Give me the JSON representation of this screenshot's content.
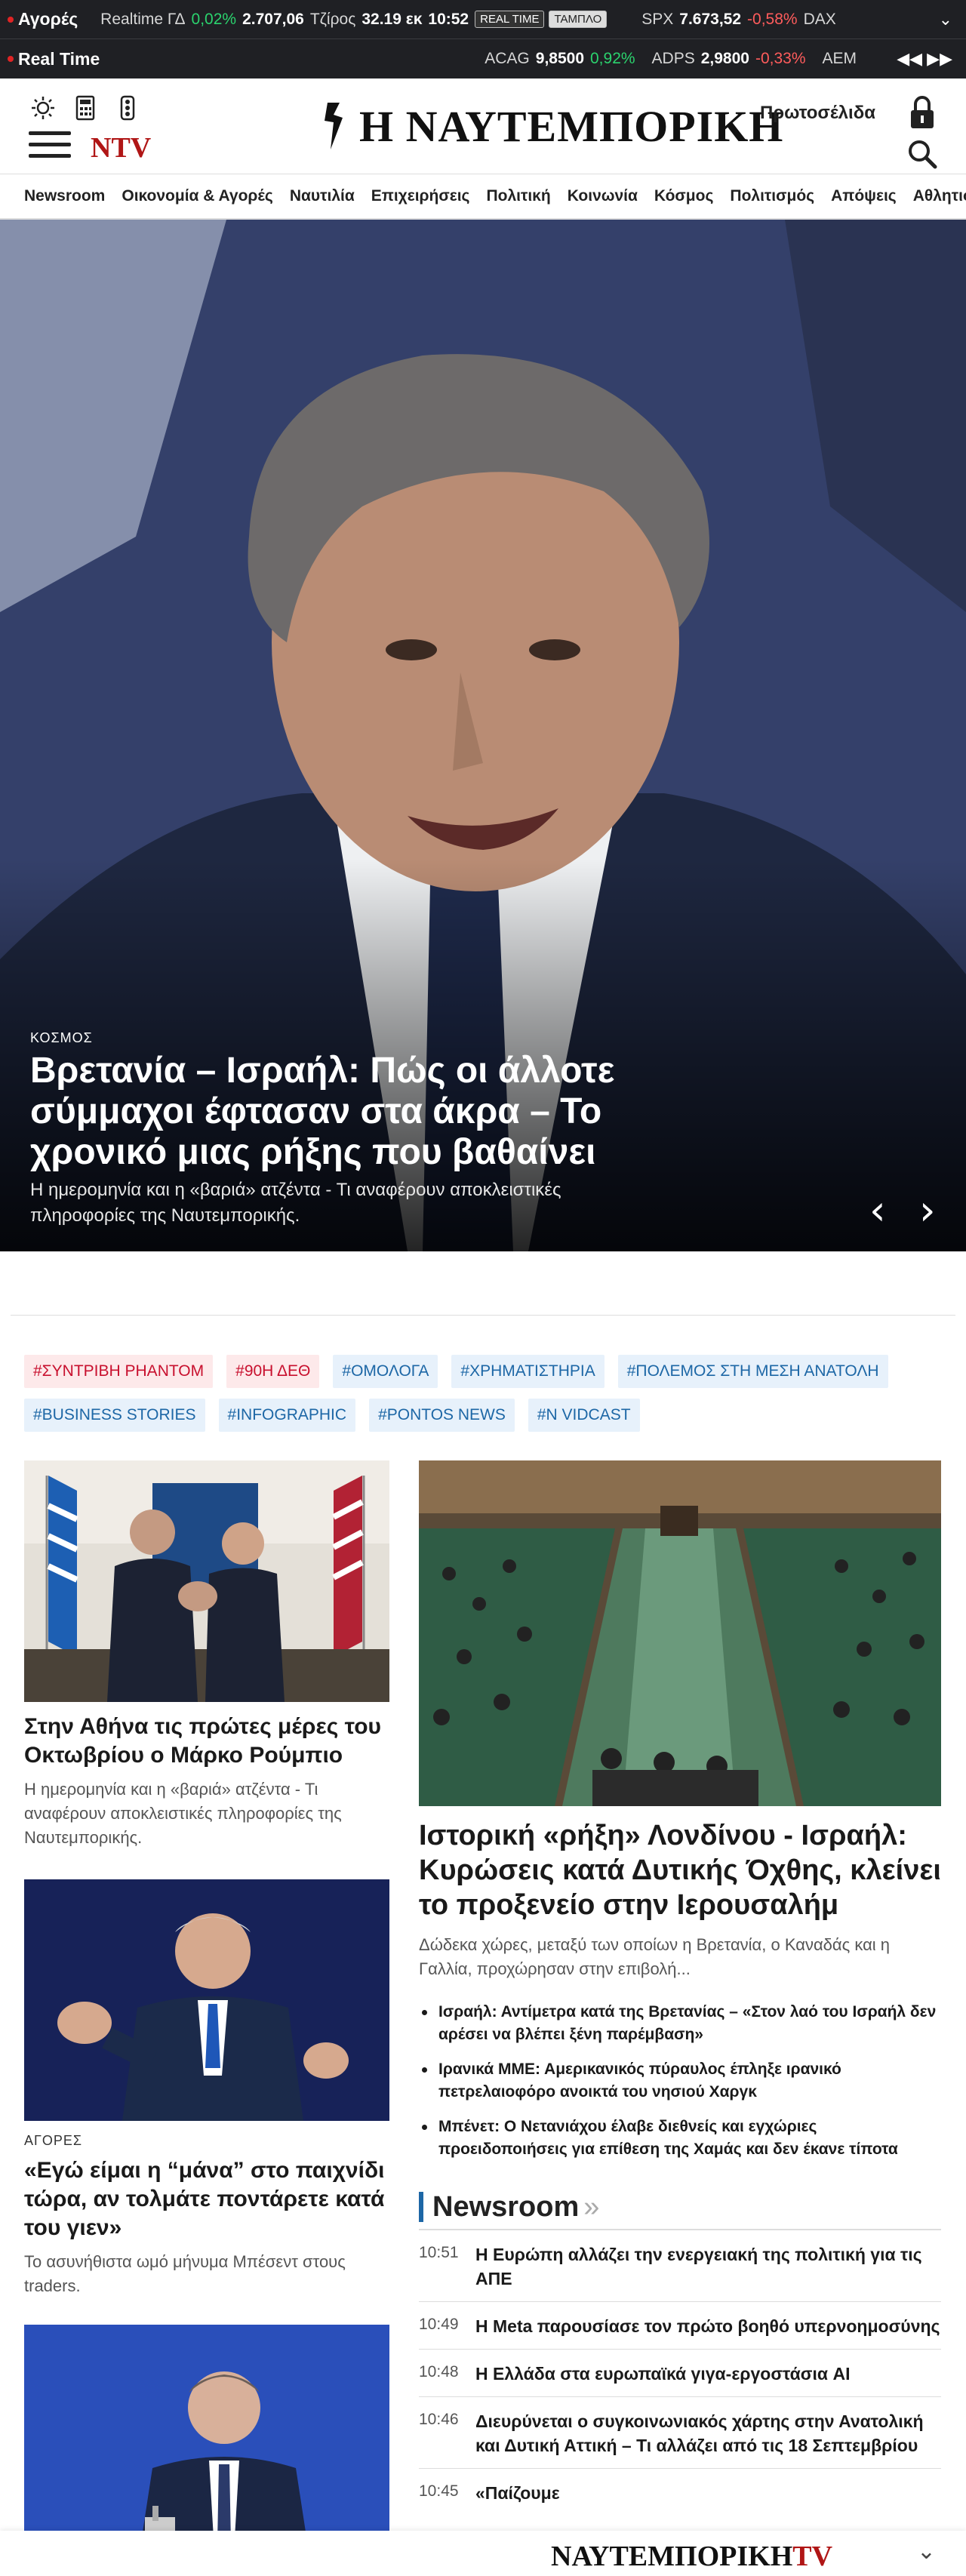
{
  "ticker": {
    "markets_label": "Αγορές",
    "realtime_label": "Realtime ΓΔ",
    "gd_change": "0,02%",
    "gd_value": "2.707,06",
    "turnover_label": "Τζίρος",
    "turnover_value": "32.19 εκ",
    "time": "10:52",
    "btn_realtime": "REAL TIME",
    "btn_board": "ΤΑΜΠΛΟ",
    "spx_label": "SPX",
    "spx_value": "7.673,52",
    "spx_change": "-0,58%",
    "dax_label": "DAX",
    "row2_label": "Real Time",
    "acag_label": "ACAG",
    "acag_value": "9,8500",
    "acag_change": "0,92%",
    "adps_label": "ADPS",
    "adps_value": "2,9800",
    "adps_change": "-0,33%",
    "aem_label": "AEM",
    "nav_arrows": "◀◀ ▶▶"
  },
  "header": {
    "logo_text": "Η ΝΑΥΤΕΜΠΟΡΙΚΗ",
    "ntv": "NTV",
    "frontpages": "Πρωτοσέλιδα"
  },
  "nav": [
    "Newsroom",
    "Οικονομία & Αγορές",
    "Ναυτιλία",
    "Επιχειρήσεις",
    "Πολιτική",
    "Κοινωνία",
    "Κόσμος",
    "Πολιτισμός",
    "Απόψεις",
    "Αθλητισμός"
  ],
  "hero": {
    "category": "ΚΟΣΜΟΣ",
    "title": "Βρετανία – Ισραήλ: Πώς οι άλλοτε σύμμαχοι έφτασαν στα άκρα – Το χρονικό μιας ρήξης που βαθαίνει",
    "subtitle": "Η ημερομηνία και η «βαριά» ατζέντα - Τι αναφέρουν αποκλειστικές πληροφορίες της Ναυτεμπορικής.",
    "prev": "‹",
    "next": "›"
  },
  "tags": [
    {
      "label": "#ΣΥΝΤΡΙΒΗ ΡΗΑΝΤΟΜ",
      "color": "red"
    },
    {
      "label": "#90Η ΔΕΘ",
      "color": "red"
    },
    {
      "label": "#ΟΜΟΛΟΓΑ",
      "color": "blue"
    },
    {
      "label": "#ΧΡΗΜΑΤΙΣΤΗΡΙΑ",
      "color": "blue"
    },
    {
      "label": "#ΠΟΛΕΜΟΣ ΣΤΗ ΜΕΣΗ ΑΝΑΤΟΛΗ",
      "color": "blue"
    },
    {
      "label": "#BUSINESS STORIES",
      "color": "blue"
    },
    {
      "label": "#INFOGRAPHIC",
      "color": "blue"
    },
    {
      "label": "#PONTOS NEWS",
      "color": "blue"
    },
    {
      "label": "#N VIDCAST",
      "color": "blue"
    }
  ],
  "articles": {
    "a1": {
      "title": "Στην Αθήνα τις πρώτες μέρες του Οκτωβρίου ο Μάρκο Ρούμπιο",
      "subtitle": "Η ημερομηνία και η «βαριά» ατζέντα - Τι αναφέρουν αποκλειστικές πληροφορίες της Ναυτεμπορικής."
    },
    "a2": {
      "category": "ΑΓΟΡΕΣ",
      "title": "«Εγώ είμαι η “μάνα” στο παιχνίδι τώρα, αν τολμάτε ποντάρετε κατά του γιεν»",
      "subtitle": "Το ασυνήθιστα ωμό μήνυμα Μπέσεντ στους traders."
    },
    "main": {
      "title": "Ιστορική «ρήξη» Λονδίνου - Ισραήλ: Κυρώσεις κατά Δυτικής Όχθης, κλείνει το προξενείο στην Ιερουσαλήμ",
      "subtitle": "Δώδεκα χώρες, μεταξύ των οποίων η Βρετανία, ο Καναδάς και η Γαλλία, προχώρησαν στην επιβολή...",
      "bullets": [
        "Ισραήλ: Αντίμετρα κατά της Βρετανίας – «Στον λαό του Ισραήλ δεν αρέσει να βλέπει ξένη παρέμβαση»",
        "Ιρανικά ΜΜΕ: Αμερικανικός πύραυλος έπληξε ιρανικό πετρελαιοφόρο ανοικτά του νησιού Χαργκ",
        "Μπένετ: Ο Νετανιάχου έλαβε διεθνείς και εγχώριες προειδοποιήσεις για επίθεση της Χαμάς και δεν έκανε τίποτα"
      ]
    }
  },
  "newsroom": {
    "title": "Newsroom",
    "arrows": "»",
    "items": [
      {
        "time": "10:51",
        "title": "Η Ευρώπη αλλάζει την ενεργειακή της πολιτική για τις ΑΠΕ"
      },
      {
        "time": "10:49",
        "title": "Η Meta παρουσίασε τον πρώτο βοηθό υπερνοημοσύνης"
      },
      {
        "time": "10:48",
        "title": "Η Ελλάδα στα ευρωπαϊκά γιγα-εργοστάσια AI"
      },
      {
        "time": "10:46",
        "title": "Διευρύνεται ο συγκοινωνιακός χάρτης στην Ανατολική και Δυτική Αττική – Τι αλλάζει από τις 18 Σεπτεμβρίου"
      },
      {
        "time": "10:45",
        "title": "«Παίζουμε"
      }
    ]
  },
  "bottombar": {
    "logo_main": "ΝΑΥΤΕΜΠΟΡΙΚΗ",
    "logo_tv": "TV",
    "chevron": "⌄"
  }
}
